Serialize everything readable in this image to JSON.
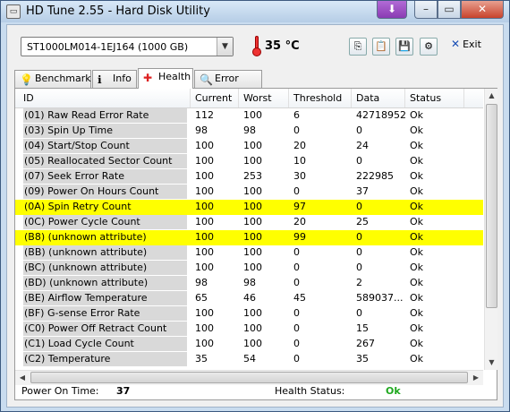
{
  "window": {
    "title": "HD Tune 2.55 - Hard Disk Utility",
    "app_icon": "hdtune-icon"
  },
  "toolbar": {
    "drive": "ST1000LM014-1EJ164 (1000 GB)",
    "temperature": "35 °C",
    "exit_label": "Exit"
  },
  "tabs": [
    {
      "label": "Benchmark",
      "icon": "lightbulb-icon"
    },
    {
      "label": "Info",
      "icon": "info-icon"
    },
    {
      "label": "Health",
      "icon": "health-cross-icon",
      "active": true
    },
    {
      "label": "Error Scan",
      "icon": "magnifier-icon"
    }
  ],
  "table": {
    "headers": [
      "ID",
      "Current",
      "Worst",
      "Threshold",
      "Data",
      "Status"
    ],
    "rows": [
      [
        "(01) Raw Read Error Rate",
        "112",
        "100",
        "6",
        "42718952",
        "Ok"
      ],
      [
        "(03) Spin Up Time",
        "98",
        "98",
        "0",
        "0",
        "Ok"
      ],
      [
        "(04) Start/Stop Count",
        "100",
        "100",
        "20",
        "24",
        "Ok"
      ],
      [
        "(05) Reallocated Sector Count",
        "100",
        "100",
        "10",
        "0",
        "Ok"
      ],
      [
        "(07) Seek Error Rate",
        "100",
        "253",
        "30",
        "222985",
        "Ok"
      ],
      [
        "(09) Power On Hours Count",
        "100",
        "100",
        "0",
        "37",
        "Ok"
      ],
      [
        "(0A) Spin Retry Count",
        "100",
        "100",
        "97",
        "0",
        "Ok"
      ],
      [
        "(0C) Power Cycle Count",
        "100",
        "100",
        "20",
        "25",
        "Ok"
      ],
      [
        "(B8) (unknown attribute)",
        "100",
        "100",
        "99",
        "0",
        "Ok"
      ],
      [
        "(BB) (unknown attribute)",
        "100",
        "100",
        "0",
        "0",
        "Ok"
      ],
      [
        "(BC) (unknown attribute)",
        "100",
        "100",
        "0",
        "0",
        "Ok"
      ],
      [
        "(BD) (unknown attribute)",
        "98",
        "98",
        "0",
        "2",
        "Ok"
      ],
      [
        "(BE) Airflow Temperature",
        "65",
        "46",
        "45",
        "589037...",
        "Ok"
      ],
      [
        "(BF) G-sense Error Rate",
        "100",
        "100",
        "0",
        "0",
        "Ok"
      ],
      [
        "(C0) Power Off Retract Count",
        "100",
        "100",
        "0",
        "15",
        "Ok"
      ],
      [
        "(C1) Load Cycle Count",
        "100",
        "100",
        "0",
        "267",
        "Ok"
      ],
      [
        "(C2) Temperature",
        "35",
        "54",
        "0",
        "35",
        "Ok"
      ]
    ],
    "highlighted_rows": [
      6,
      8
    ],
    "highlight_color": "#ffff00"
  },
  "footer": {
    "power_on_label": "Power On Time:",
    "power_on_value": "37",
    "health_label": "Health Status:",
    "health_value": "Ok",
    "health_color": "#1fa81f"
  }
}
